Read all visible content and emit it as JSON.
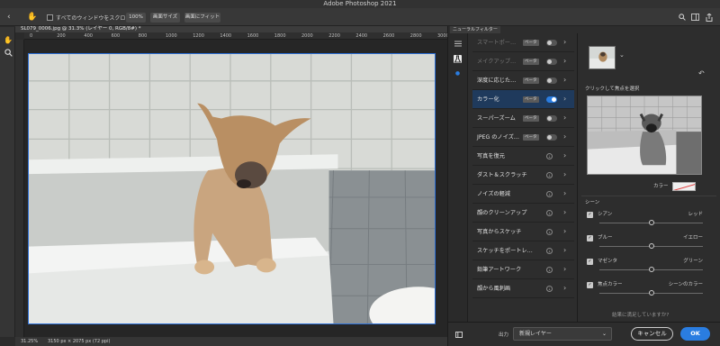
{
  "window": {
    "title": "Adobe Photoshop 2021"
  },
  "options_bar": {
    "home_icon": "chevron-left-icon",
    "hand_icon": "hand-icon",
    "scroll_all_label": "すべてのウィンドウをスクロール",
    "zoom_100": "100%",
    "fit_screen": "画面サイズ",
    "fill_screen": "画面にフィット",
    "right_icons": [
      "search-icon",
      "panel-icon",
      "share-icon"
    ]
  },
  "toolbar": {
    "tools": [
      "hand-tool-icon",
      "zoom-tool-icon"
    ]
  },
  "document": {
    "tab_title": "SL079_0006.jpg @ 31.3% (レイヤー 0, RGB/8#) *",
    "ruler_labels": [
      "0",
      "200",
      "400",
      "600",
      "800",
      "1000",
      "1200",
      "1400",
      "1600",
      "1800",
      "2000",
      "2200",
      "2400",
      "2600",
      "2800",
      "3000"
    ]
  },
  "status": {
    "zoom": "31.25%",
    "dimensions": "3150 px × 2075 px (72 ppi)"
  },
  "neural_filters": {
    "panel_title": "ニューラルフィルター",
    "side_icons": [
      "filters-list-icon",
      "flask-icon",
      "dot-icon"
    ],
    "filters": [
      {
        "label": "スマートポー…",
        "badge": "ベータ",
        "control": "toggle",
        "on": false,
        "dim": true
      },
      {
        "label": "メイクアップ…",
        "badge": "ベータ",
        "control": "toggle",
        "on": false,
        "dim": true
      },
      {
        "label": "深度に応じた…",
        "badge": "ベータ",
        "control": "toggle",
        "on": false,
        "dim": false
      },
      {
        "label": "カラー化",
        "badge": "ベータ",
        "control": "toggle",
        "on": true,
        "dim": false,
        "active": true
      },
      {
        "label": "スーパーズーム",
        "badge": "ベータ",
        "control": "toggle",
        "on": false,
        "dim": false
      },
      {
        "label": "JPEG のノイズ…",
        "badge": "ベータ",
        "control": "toggle",
        "on": false,
        "dim": false
      },
      {
        "label": "写真を復元",
        "badge": "",
        "control": "download",
        "dim": false
      },
      {
        "label": "ダスト＆スクラッチ",
        "badge": "",
        "control": "download",
        "dim": false
      },
      {
        "label": "ノイズの軽減",
        "badge": "",
        "control": "download",
        "dim": false
      },
      {
        "label": "顔のクリーンアップ",
        "badge": "",
        "control": "download",
        "dim": false
      },
      {
        "label": "写真からスケッチ",
        "badge": "",
        "control": "download",
        "dim": false
      },
      {
        "label": "スケッチをポートレ…",
        "badge": "",
        "control": "download",
        "dim": false
      },
      {
        "label": "鉛筆アートワーク",
        "badge": "",
        "control": "download",
        "dim": false
      },
      {
        "label": "顔から風刺画",
        "badge": "",
        "control": "download",
        "dim": false
      }
    ],
    "params": {
      "focus_label": "クリックして焦点を選択",
      "color_label": "カラー",
      "scene_label": "シーン",
      "sliders": [
        {
          "left": "シアン",
          "right": "レッド",
          "value": 0.5,
          "checked": true
        },
        {
          "left": "ブルー",
          "right": "イエロー",
          "value": 0.5,
          "checked": true
        },
        {
          "left": "マゼンタ",
          "right": "グリーン",
          "value": 0.5,
          "checked": true
        },
        {
          "left": "焦点カラー",
          "right": "シーンのカラー",
          "value": 0.5,
          "checked": true
        }
      ],
      "bottom_hint": "結果に満足していますか?"
    },
    "footer": {
      "output_label": "出力",
      "output_value": "新規レイヤー",
      "cancel": "キャンセル",
      "ok": "OK"
    }
  },
  "colors": {
    "accent": "#2a7de1",
    "selected_row": "#1f3a5c",
    "panel_bg": "#2d2d2d"
  }
}
